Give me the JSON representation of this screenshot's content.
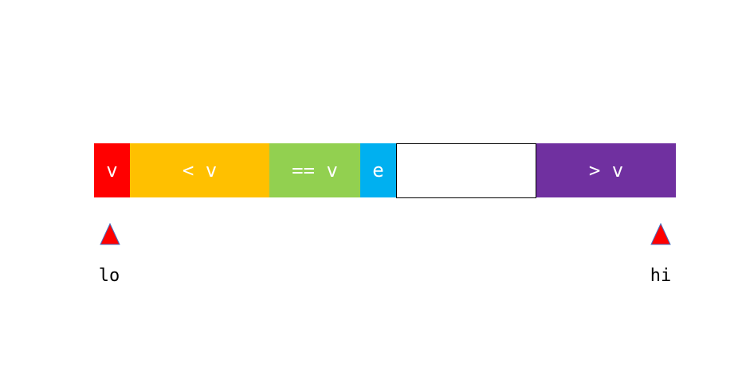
{
  "segments": [
    {
      "label": "v",
      "color": "#ff0000"
    },
    {
      "label": "< v",
      "color": "#ffc000"
    },
    {
      "label": "== v",
      "color": "#92d050"
    },
    {
      "label": "e",
      "color": "#00b0f0"
    },
    {
      "label": "",
      "color": "#ffffff"
    },
    {
      "label": "> v",
      "color": "#7030a0"
    }
  ],
  "pointers": [
    {
      "label": "lo",
      "icon": "triangle-up-icon",
      "color": "#ff0000"
    },
    {
      "label": "hi",
      "icon": "triangle-up-icon",
      "color": "#ff0000"
    }
  ]
}
